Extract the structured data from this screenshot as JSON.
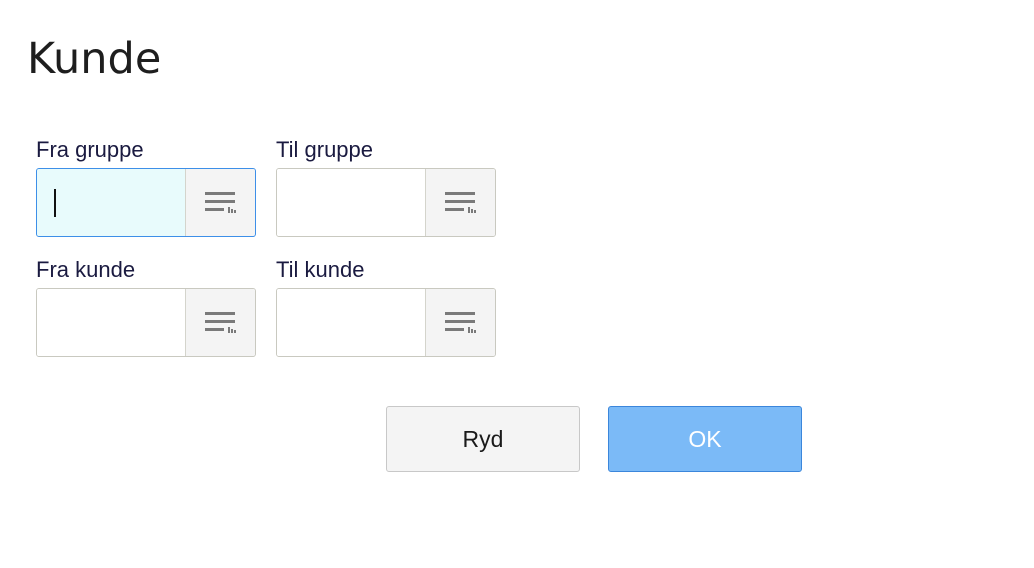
{
  "page": {
    "title": "Kunde"
  },
  "fields": {
    "from_group": {
      "label": "Fra gruppe",
      "value": ""
    },
    "to_group": {
      "label": "Til gruppe",
      "value": ""
    },
    "from_customer": {
      "label": "Fra kunde",
      "value": ""
    },
    "to_customer": {
      "label": "Til kunde",
      "value": ""
    }
  },
  "icons": {
    "lookup": "list-lookup-icon"
  },
  "buttons": {
    "clear_label": "Ryd",
    "ok_label": "OK"
  },
  "colors": {
    "focus_border": "#3d8fe8",
    "focus_fill": "#e8fbfc",
    "ok_fill": "#7bbaf7",
    "ok_border": "#3b86db"
  }
}
